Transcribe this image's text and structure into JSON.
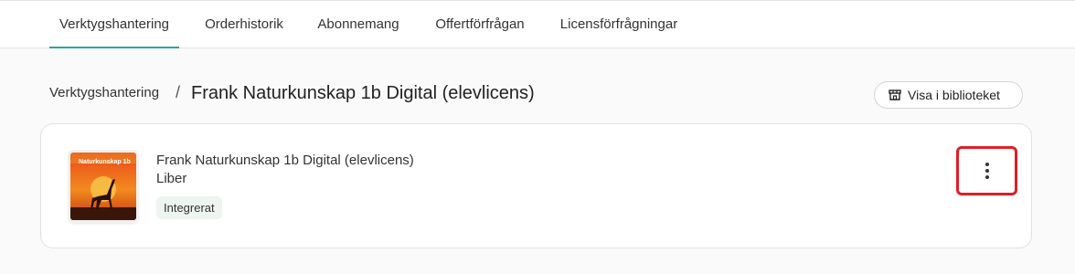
{
  "tabs": [
    {
      "label": "Verktygshantering",
      "active": true
    },
    {
      "label": "Orderhistorik",
      "active": false
    },
    {
      "label": "Abonnemang",
      "active": false
    },
    {
      "label": "Offertförfrågan",
      "active": false
    },
    {
      "label": "Licensförfrågningar",
      "active": false
    }
  ],
  "breadcrumb": {
    "root": "Verktygshantering",
    "separator": "/",
    "current": "Frank Naturkunskap 1b Digital (elevlicens)"
  },
  "library_button": {
    "label": "Visa i biblioteket",
    "icon": "store-icon"
  },
  "product": {
    "title": "Frank Naturkunskap 1b Digital (elevlicens)",
    "publisher": "Liber",
    "badge": "Integrerat",
    "cover_text": "Naturkunskap 1b",
    "menu_icon": "more-vertical-icon"
  },
  "colors": {
    "accent": "#2aa3a3",
    "highlight": "#e01e26",
    "badge_bg": "#eef4f0"
  }
}
